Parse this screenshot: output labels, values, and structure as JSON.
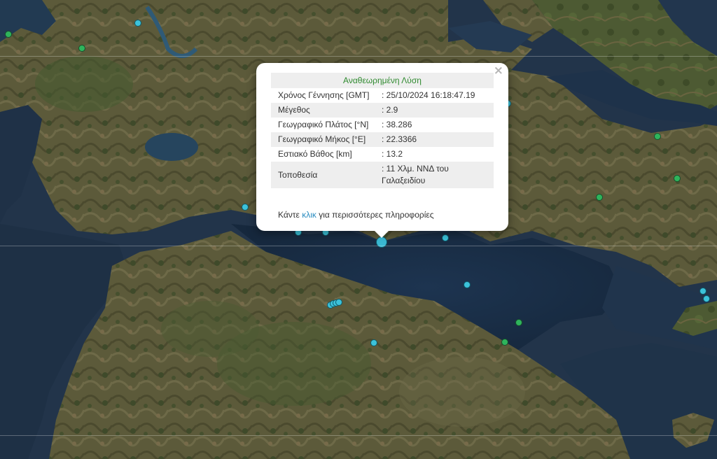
{
  "map": {
    "background": "satellite",
    "marker_colors": {
      "cyan": "#3cc2da",
      "green": "#2fb45c",
      "selected": "#3ab8d3"
    }
  },
  "popup": {
    "title": "Αναθεωρημένη Λύση",
    "close_symbol": "×",
    "rows": [
      {
        "label": "Χρόνος Γέννησης [GMT]",
        "value": ": 25/10/2024 16:18:47.19"
      },
      {
        "label": "Μέγεθος",
        "value": ": 2.9"
      },
      {
        "label": "Γεωγραφικό Πλάτος [°N]",
        "value": ": 38.286"
      },
      {
        "label": "Γεωγραφικό Μήκος [°E]",
        "value": ": 22.3366"
      },
      {
        "label": "Εστιακό Βάθος [km]",
        "value": ": 13.2"
      },
      {
        "label": "Τοποθεσία",
        "value": ": 11 Χλμ. ΝΝΔ του Γαλαξειδίου"
      }
    ],
    "footer_before": "Κάντε ",
    "footer_link": "κλικ",
    "footer_after": " για περισσότερες πληροφορίες"
  }
}
